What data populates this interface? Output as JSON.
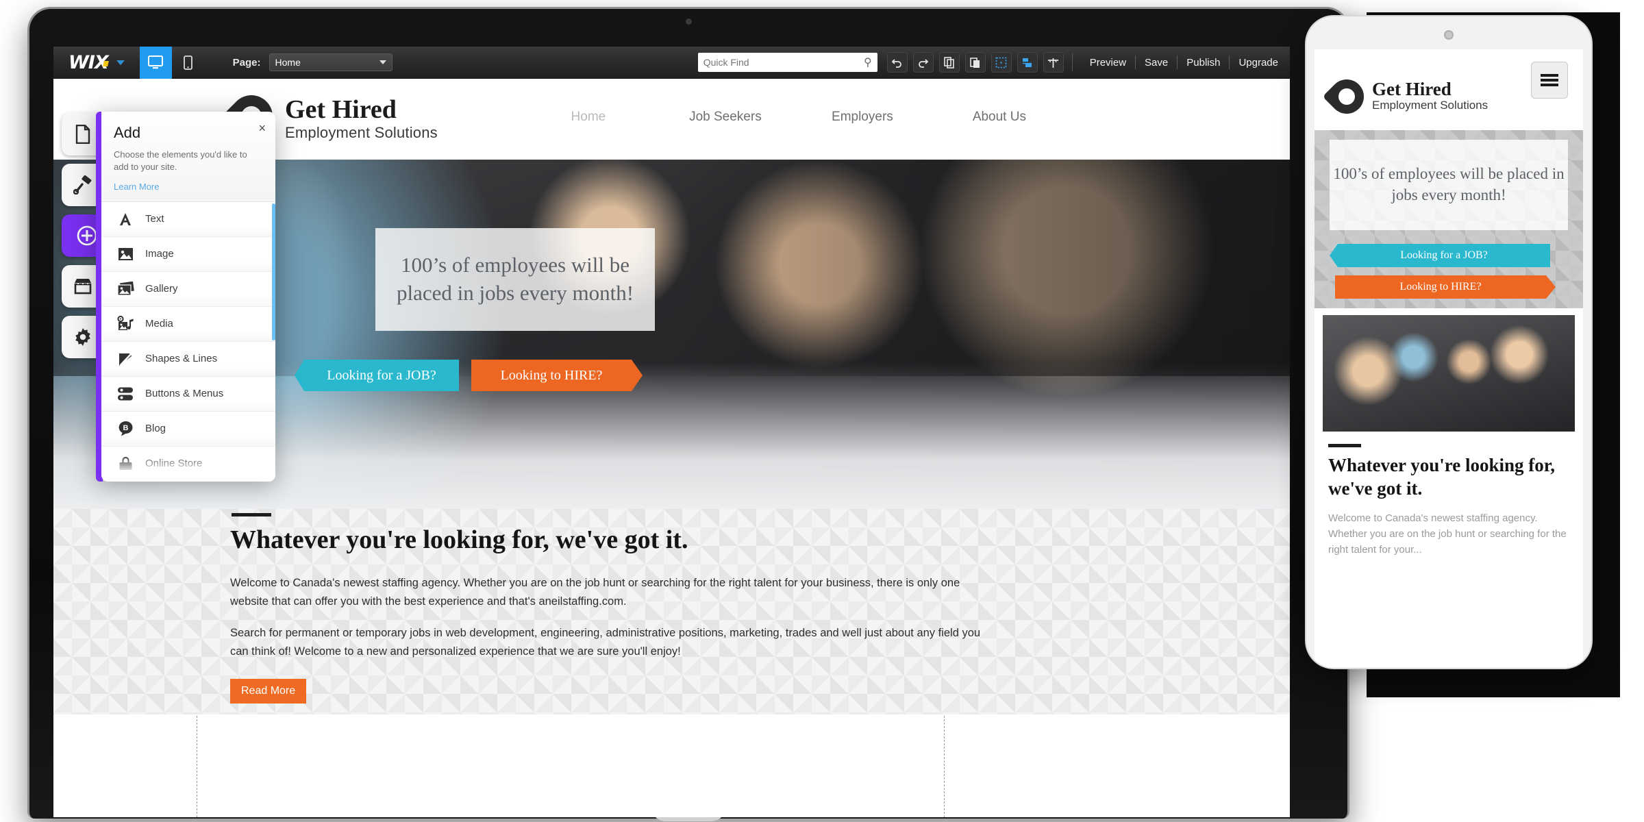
{
  "editor": {
    "brand": "WIX",
    "view_desktop_icon": "desktop-icon",
    "view_mobile_icon": "mobile-icon",
    "page_label": "Page:",
    "page_value": "Home",
    "search_placeholder": "Quick Find",
    "tools": [
      {
        "name": "undo-icon",
        "glyph": "↶"
      },
      {
        "name": "redo-icon",
        "glyph": "↷"
      },
      {
        "name": "copy-icon",
        "glyph": "❐"
      },
      {
        "name": "paste-icon",
        "glyph": "⎘"
      },
      {
        "name": "grid-icon",
        "glyph": "⬚"
      },
      {
        "name": "snap-icon",
        "glyph": "◰"
      },
      {
        "name": "ruler-icon",
        "glyph": "┼"
      }
    ],
    "links": [
      "Preview",
      "Save",
      "Publish",
      "Upgrade"
    ]
  },
  "rail": {
    "items": [
      {
        "name": "pages-icon",
        "label": "Pages",
        "glyph": "὜b",
        "active": false
      },
      {
        "name": "design-icon",
        "label": "Design",
        "glyph": "✎",
        "active": false
      },
      {
        "name": "add-icon",
        "label": "Add",
        "glyph": "+",
        "active": true
      },
      {
        "name": "market-icon",
        "label": "App Market",
        "glyph": "⌂",
        "active": false
      },
      {
        "name": "settings-icon",
        "label": "Settings",
        "glyph": "⚙",
        "active": false
      }
    ]
  },
  "add_panel": {
    "title": "Add",
    "close_label": "×",
    "description": "Choose the elements you'd like to add to your site.",
    "learn_more": "Learn More",
    "items": [
      {
        "label": "Text",
        "icon": "text-icon"
      },
      {
        "label": "Image",
        "icon": "image-icon"
      },
      {
        "label": "Gallery",
        "icon": "gallery-icon"
      },
      {
        "label": "Media",
        "icon": "media-icon"
      },
      {
        "label": "Shapes & Lines",
        "icon": "shapes-icon"
      },
      {
        "label": "Buttons & Menus",
        "icon": "buttons-icon"
      },
      {
        "label": "Blog",
        "icon": "blog-icon"
      },
      {
        "label": "Online Store",
        "icon": "store-icon"
      }
    ]
  },
  "site": {
    "brand_name": "Get Hired",
    "brand_sub": "Employment Solutions",
    "nav": [
      "Home",
      "Job Seekers",
      "Employers",
      "About Us"
    ],
    "hero_headline": "100’s of employees will be placed in jobs every month!",
    "cta_job": "Looking for a JOB?",
    "cta_hire": "Looking to HIRE?",
    "section_heading": "Whatever you're looking for, we've got it.",
    "paragraph_1": "Welcome to Canada's newest staffing agency. Whether you are on the job hunt or searching for the right talent for your business, there is only one website that can offer you with the best experience and that's aneilstaffing.com.",
    "paragraph_2": "Search for permanent or temporary jobs in web development, engineering, administrative positions, marketing, trades and well just about any field you can think of! Welcome to a new and personalized experience that we are sure you'll enjoy!",
    "read_more": "Read More"
  },
  "mobile": {
    "brand_name": "Get Hired",
    "brand_sub": "Employment Solutions",
    "menu_icon": "hamburger-icon",
    "hero_headline": "100’s of employees will be placed in jobs every month!",
    "cta_job": "Looking for a JOB?",
    "cta_hire": "Looking to HIRE?",
    "section_heading": "Whatever you're looking for, we've got it.",
    "paragraph_1": "Welcome to Canada's newest staffing agency. Whether you are on the job hunt or searching for the right talent for your..."
  },
  "colors": {
    "accent_teal": "#29b8ce",
    "accent_orange": "#ee6722",
    "editor_purple": "#7a30f0",
    "editor_blue": "#1f9cf0"
  }
}
